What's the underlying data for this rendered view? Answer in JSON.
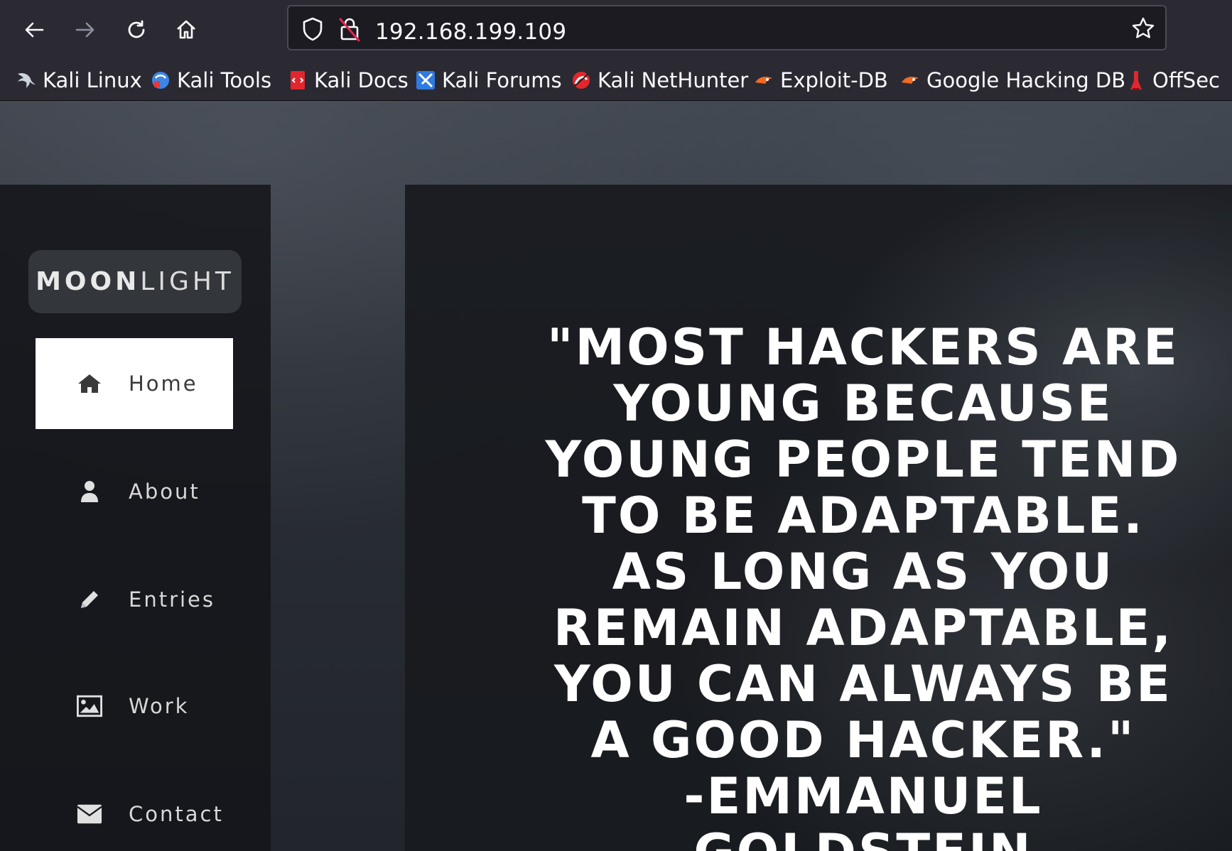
{
  "browser": {
    "url": "192.168.199.109",
    "bookmarks": [
      {
        "label": "Kali Linux",
        "icon": "kali-dragon-icon"
      },
      {
        "label": "Kali Tools",
        "icon": "kali-tools-icon"
      },
      {
        "label": "Kali Docs",
        "icon": "kali-docs-icon"
      },
      {
        "label": "Kali Forums",
        "icon": "kali-forums-icon"
      },
      {
        "label": "Kali NetHunter",
        "icon": "kali-nethunter-icon"
      },
      {
        "label": "Exploit-DB",
        "icon": "exploit-db-icon"
      },
      {
        "label": "Google Hacking DB",
        "icon": "ghdb-icon"
      },
      {
        "label": "OffSec",
        "icon": "offsec-icon"
      }
    ]
  },
  "site": {
    "logo_bold": "MOON",
    "logo_light": "LIGHT",
    "menu": [
      {
        "label": "Home",
        "icon": "home-icon",
        "active": true
      },
      {
        "label": "About",
        "icon": "user-icon",
        "active": false
      },
      {
        "label": "Entries",
        "icon": "pencil-icon",
        "active": false
      },
      {
        "label": "Work",
        "icon": "image-icon",
        "active": false
      },
      {
        "label": "Contact",
        "icon": "envelope-icon",
        "active": false
      }
    ],
    "quote": "\"Most hackers are young because young people tend to be adaptable. As long as you remain adaptable, you can always be a good hacker.\"",
    "author": "-Emmanuel Goldstein"
  },
  "colors": {
    "chrome_bg": "#2b2a33",
    "page_bg": "#1c1b22",
    "active_menu_bg": "#ffffff"
  }
}
